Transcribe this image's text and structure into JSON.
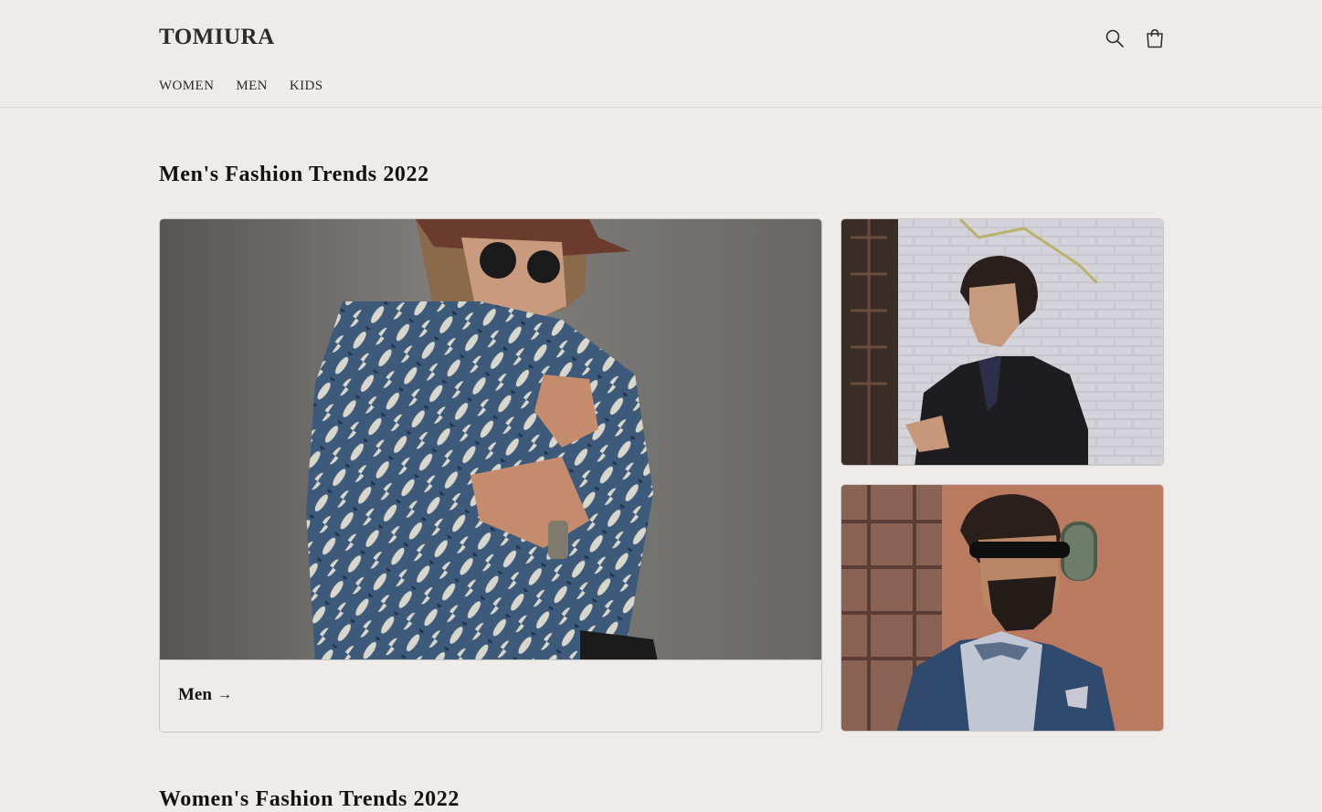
{
  "brand": {
    "name": "TOMIURA"
  },
  "header": {
    "icons": {
      "search": "search-icon",
      "cart": "cart-icon"
    },
    "nav": [
      "WOMEN",
      "MEN",
      "KIDS"
    ]
  },
  "sections": [
    {
      "title": "Men's Fashion Trends 2022",
      "main_card_label": "Men",
      "arrow": "→"
    },
    {
      "title": "Women's Fashion Trends 2022"
    }
  ],
  "colors": {
    "background": "#edecea",
    "text": "#121212",
    "border": "#c9c8c5"
  }
}
